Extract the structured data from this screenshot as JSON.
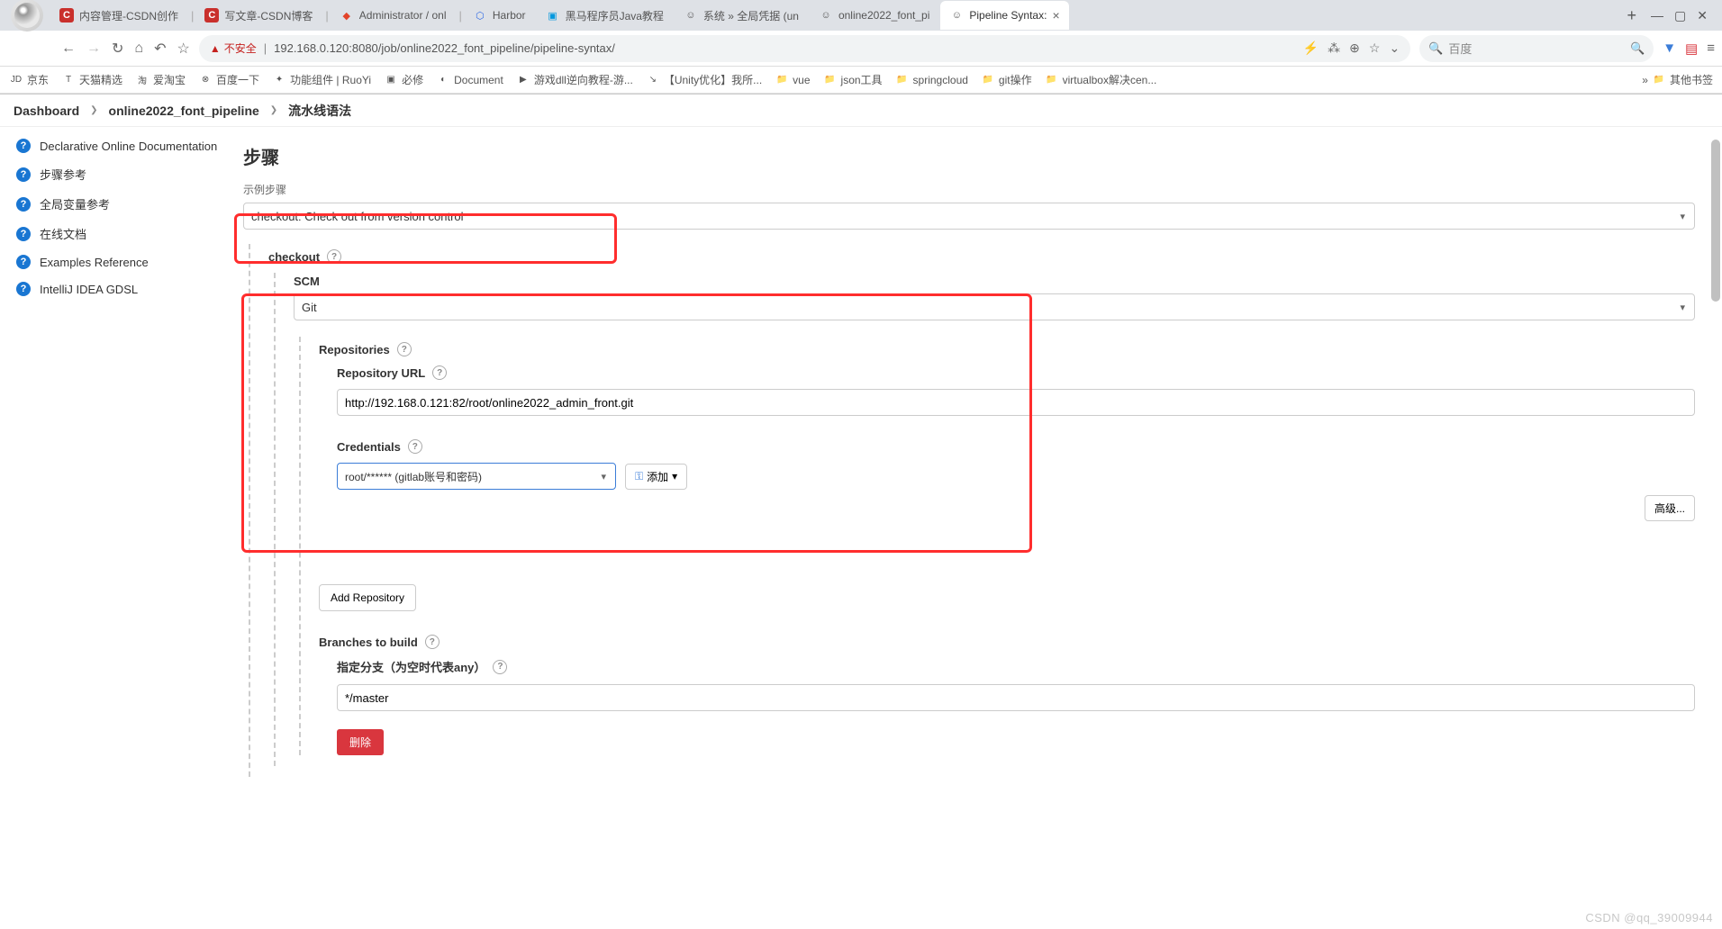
{
  "browser": {
    "tabs": [
      {
        "title": "内容管理-CSDN创作",
        "favicon": "C",
        "favclass": "fav-c"
      },
      {
        "title": "写文章-CSDN博客",
        "favicon": "C",
        "favclass": "fav-c"
      },
      {
        "title": "Administrator / onl",
        "favicon": "◆",
        "favclass": "fav-g"
      },
      {
        "title": "Harbor",
        "favicon": "⬡",
        "favclass": "fav-h"
      },
      {
        "title": "黑马程序员Java教程",
        "favicon": "▣",
        "favclass": "fav-b"
      },
      {
        "title": "系统 » 全局凭据 (un",
        "favicon": "☺",
        "favclass": "fav-j"
      },
      {
        "title": "online2022_font_pi",
        "favicon": "☺",
        "favclass": "fav-j"
      },
      {
        "title": "Pipeline Syntax:",
        "favicon": "☺",
        "favclass": "fav-j",
        "active": true
      }
    ],
    "address": {
      "warning": "不安全",
      "url": "192.168.0.120:8080/job/online2022_font_pipeline/pipeline-syntax/"
    },
    "search_placeholder": "百度",
    "bookmarks": [
      {
        "label": "京东",
        "icon": "JD"
      },
      {
        "label": "天猫精选",
        "icon": "T"
      },
      {
        "label": "爱淘宝",
        "icon": "淘"
      },
      {
        "label": "百度一下",
        "icon": "⊗"
      },
      {
        "label": "功能组件 | RuoYi",
        "icon": "✦"
      },
      {
        "label": "必修",
        "icon": "▣"
      },
      {
        "label": "Document",
        "icon": "◐"
      },
      {
        "label": "游戏dll逆向教程-游...",
        "icon": "▶"
      },
      {
        "label": "【Unity优化】我所...",
        "icon": "↘"
      },
      {
        "label": "vue",
        "icon": "📁"
      },
      {
        "label": "json工具",
        "icon": "📁"
      },
      {
        "label": "springcloud",
        "icon": "📁"
      },
      {
        "label": "git操作",
        "icon": "📁"
      },
      {
        "label": "virtualbox解决cen...",
        "icon": "📁"
      }
    ],
    "bookmarks_more": "其他书签"
  },
  "breadcrumb": {
    "items": [
      "Dashboard",
      "online2022_font_pipeline",
      "流水线语法"
    ]
  },
  "sidebar": {
    "items": [
      "Declarative Online Documentation",
      "步骤参考",
      "全局变量参考",
      "在线文档",
      "Examples Reference",
      "IntelliJ IDEA GDSL"
    ]
  },
  "page": {
    "title": "步骤",
    "sample_step_label": "示例步骤",
    "sample_step_value": "checkout: Check out from version control",
    "checkout_label": "checkout",
    "scm_label": "SCM",
    "scm_value": "Git",
    "repositories_label": "Repositories",
    "repo_url_label": "Repository URL",
    "repo_url_value": "http://192.168.0.121:82/root/online2022_admin_front.git",
    "credentials_label": "Credentials",
    "credentials_value": "root/****** (gitlab账号和密码)",
    "add_btn": "添加",
    "advanced_btn": "高级...",
    "add_repo_btn": "Add Repository",
    "branches_label": "Branches to build",
    "branch_spec_label": "指定分支（为空时代表any）",
    "branch_value": "*/master",
    "delete_btn": "删除"
  },
  "watermark": "CSDN @qq_39009944"
}
